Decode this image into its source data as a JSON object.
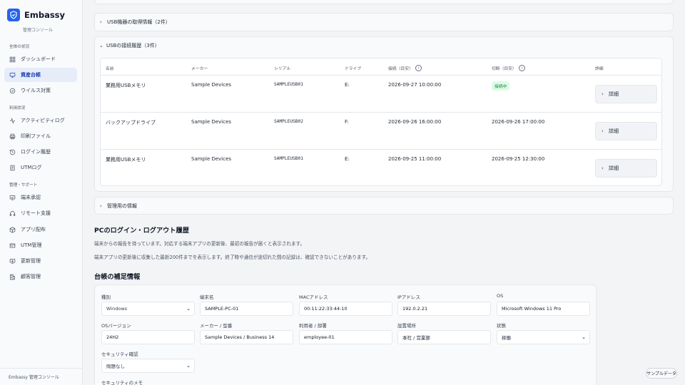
{
  "brand": {
    "name": "Embassy",
    "subtitle": "管理コンソール"
  },
  "sidebar": {
    "sections": [
      {
        "title": "全体の状況"
      },
      {
        "title": "利用状況"
      },
      {
        "title": "管理・サポート"
      }
    ],
    "items": [
      {
        "label": "ダッシュボード",
        "icon": "dashboard-icon"
      },
      {
        "label": "資産台帳",
        "icon": "monitor-icon",
        "active": true
      },
      {
        "label": "ウイルス対策",
        "icon": "check-circle-icon"
      },
      {
        "label": "アクティビティログ",
        "icon": "activity-icon"
      },
      {
        "label": "印刷ファイル",
        "icon": "printer-icon"
      },
      {
        "label": "ログイン履歴",
        "icon": "history-icon"
      },
      {
        "label": "UTMログ",
        "icon": "document-icon"
      },
      {
        "label": "端末承認",
        "icon": "approve-icon"
      },
      {
        "label": "リモート支援",
        "icon": "headset-icon"
      },
      {
        "label": "アプリ配布",
        "icon": "package-icon"
      },
      {
        "label": "UTM管理",
        "icon": "utm-icon"
      },
      {
        "label": "更新管理",
        "icon": "update-icon"
      },
      {
        "label": "顧客管理",
        "icon": "building-icon"
      }
    ],
    "footer": "Embassy 管理コンソール"
  },
  "sections": {
    "usb_info": "USB機器の取得情報（2件）",
    "usb_history": "USBの接続履歴（3件）",
    "admin_info": "管理用の情報"
  },
  "usb_table": {
    "headers": [
      "名前",
      "メーカー",
      "シリアル",
      "ドライブ",
      "接続（目安）",
      "切断（目安）",
      "詳細"
    ],
    "rows": [
      {
        "name": "業務用USBメモリ",
        "maker": "Sample Devices",
        "serial": "SAMPLEUSB01",
        "drive": "E:",
        "connected": "2026-09-27 10:00:00",
        "disconnected": "",
        "status": "接続中",
        "detail": "詳細"
      },
      {
        "name": "バックアップドライブ",
        "maker": "Sample Devices",
        "serial": "SAMPLEUSB02",
        "drive": "F:",
        "connected": "2026-09-26 16:00:00",
        "disconnected": "2026-09-26 17:00:00",
        "status": "",
        "detail": "詳細"
      },
      {
        "name": "業務用USBメモリ",
        "maker": "Sample Devices",
        "serial": "SAMPLEUSB01",
        "drive": "E:",
        "connected": "2026-09-25 11:00:00",
        "disconnected": "2026-09-25 12:30:00",
        "status": "",
        "detail": "詳細"
      }
    ],
    "status_color": "#15803d"
  },
  "login_section": {
    "title": "PCのログイン・ログアウト履歴",
    "line1": "端末からの報告を待っています。対応する端末アプリの更新後、最初の報告が届くと表示されます。",
    "line2": "端末アプリの更新後に収集した最新200件までを表示します。終了時や通信が途切れた間の記録は、確認できないことがあります。"
  },
  "ledger": {
    "title": "台帳の補足情報",
    "fields": {
      "type": {
        "label": "種別",
        "value": "Windows"
      },
      "hostname": {
        "label": "端末名",
        "value": "SAMPLE-PC-01"
      },
      "mac": {
        "label": "MACアドレス",
        "value": "00:11:22:33:44:10"
      },
      "ip": {
        "label": "IPアドレス",
        "value": "192.0.2.21"
      },
      "os": {
        "label": "OS",
        "value": "Microsoft Windows 11 Pro"
      },
      "os_version": {
        "label": "OSバージョン",
        "value": "24H2"
      },
      "model": {
        "label": "メーカー / 型番",
        "value": "Sample Devices / Business 14"
      },
      "user": {
        "label": "利用者 / 部署",
        "value": "employee-01"
      },
      "location": {
        "label": "設置場所",
        "value": "本社 / 営業部"
      },
      "state": {
        "label": "状態",
        "value": "稼働"
      },
      "security_check": {
        "label": "セキュリティ確認",
        "value": "問題なし"
      },
      "security_memo": {
        "label": "セキュリティのメモ"
      }
    }
  },
  "sample_button": "サンプルデータ",
  "colors": {
    "accent": "#2563eb",
    "active_bg": "#e6edf9"
  }
}
